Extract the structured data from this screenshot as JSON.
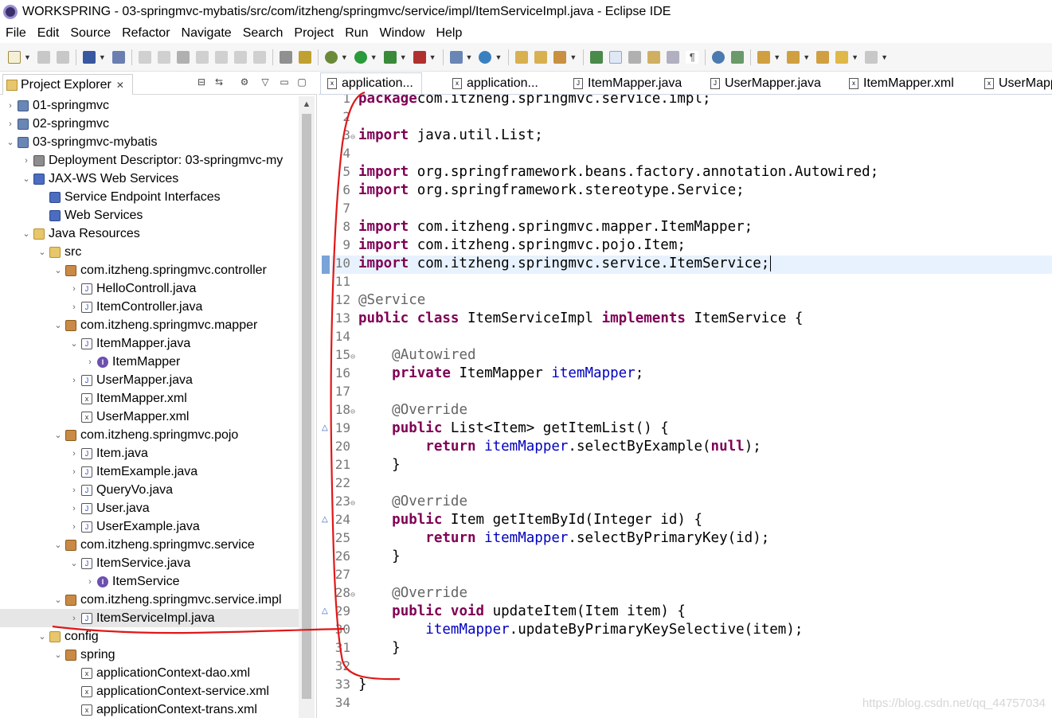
{
  "window": {
    "title": "WORKSPRING - 03-springmvc-mybatis/src/com/itzheng/springmvc/service/impl/ItemServiceImpl.java - Eclipse IDE"
  },
  "menu": [
    "File",
    "Edit",
    "Source",
    "Refactor",
    "Navigate",
    "Search",
    "Project",
    "Run",
    "Window",
    "Help"
  ],
  "explorer": {
    "title": "Project Explorer",
    "close": "✕",
    "tree": [
      {
        "label": "01-springmvc",
        "icon": "project-icon",
        "twisty": "›",
        "level": 0
      },
      {
        "label": "02-springmvc",
        "icon": "project-icon",
        "twisty": "›",
        "level": 0
      },
      {
        "label": "03-springmvc-mybatis",
        "icon": "project-icon",
        "twisty": "⌄",
        "level": 0
      },
      {
        "label": "Deployment Descriptor: 03-springmvc-my",
        "icon": "descriptor-icon",
        "twisty": "›",
        "level": 1
      },
      {
        "label": "JAX-WS Web Services",
        "icon": "webservice-icon",
        "twisty": "⌄",
        "level": 1
      },
      {
        "label": "Service Endpoint Interfaces",
        "icon": "webservice-icon",
        "twisty": "",
        "level": 2
      },
      {
        "label": "Web Services",
        "icon": "webservice-icon",
        "twisty": "",
        "level": 2
      },
      {
        "label": "Java Resources",
        "icon": "folder-icon",
        "twisty": "⌄",
        "level": 1
      },
      {
        "label": "src",
        "icon": "folder-icon",
        "twisty": "⌄",
        "level": 2
      },
      {
        "label": "com.itzheng.springmvc.controller",
        "icon": "package-icon",
        "twisty": "⌄",
        "level": 3
      },
      {
        "label": "HelloControll.java",
        "icon": "java-file-icon",
        "twisty": "›",
        "level": 4
      },
      {
        "label": "ItemController.java",
        "icon": "java-file-icon",
        "twisty": "›",
        "level": 4
      },
      {
        "label": "com.itzheng.springmvc.mapper",
        "icon": "package-icon",
        "twisty": "⌄",
        "level": 3
      },
      {
        "label": "ItemMapper.java",
        "icon": "java-file-icon",
        "twisty": "⌄",
        "level": 4
      },
      {
        "label": "ItemMapper",
        "icon": "interface-icon",
        "twisty": "›",
        "level": 5
      },
      {
        "label": "UserMapper.java",
        "icon": "java-file-icon",
        "twisty": "›",
        "level": 4
      },
      {
        "label": "ItemMapper.xml",
        "icon": "xml-file-icon",
        "twisty": "",
        "level": 4
      },
      {
        "label": "UserMapper.xml",
        "icon": "xml-file-icon",
        "twisty": "",
        "level": 4
      },
      {
        "label": "com.itzheng.springmvc.pojo",
        "icon": "package-icon",
        "twisty": "⌄",
        "level": 3
      },
      {
        "label": "Item.java",
        "icon": "java-file-icon",
        "twisty": "›",
        "level": 4
      },
      {
        "label": "ItemExample.java",
        "icon": "java-file-icon",
        "twisty": "›",
        "level": 4
      },
      {
        "label": "QueryVo.java",
        "icon": "java-file-icon",
        "twisty": "›",
        "level": 4
      },
      {
        "label": "User.java",
        "icon": "java-file-icon",
        "twisty": "›",
        "level": 4
      },
      {
        "label": "UserExample.java",
        "icon": "java-file-icon",
        "twisty": "›",
        "level": 4
      },
      {
        "label": "com.itzheng.springmvc.service",
        "icon": "package-icon",
        "twisty": "⌄",
        "level": 3
      },
      {
        "label": "ItemService.java",
        "icon": "java-file-icon",
        "twisty": "⌄",
        "level": 4
      },
      {
        "label": "ItemService",
        "icon": "interface-icon",
        "twisty": "›",
        "level": 5
      },
      {
        "label": "com.itzheng.springmvc.service.impl",
        "icon": "package-icon",
        "twisty": "⌄",
        "level": 3
      },
      {
        "label": "ItemServiceImpl.java",
        "icon": "java-file-icon",
        "twisty": "›",
        "level": 4,
        "selected": true
      },
      {
        "label": "config",
        "icon": "folder-icon",
        "twisty": "⌄",
        "level": 2
      },
      {
        "label": "spring",
        "icon": "package-icon",
        "twisty": "⌄",
        "level": 3
      },
      {
        "label": "applicationContext-dao.xml",
        "icon": "xml-file-icon",
        "twisty": "",
        "level": 4
      },
      {
        "label": "applicationContext-service.xml",
        "icon": "xml-file-icon",
        "twisty": "",
        "level": 4
      },
      {
        "label": "applicationContext-trans.xml",
        "icon": "xml-file-icon",
        "twisty": "",
        "level": 4
      }
    ]
  },
  "editor": {
    "tabs": [
      {
        "label": "application...",
        "kind": "x",
        "active": true
      },
      {
        "label": "application...",
        "kind": "x"
      },
      {
        "label": "ItemMapper.java",
        "kind": "J"
      },
      {
        "label": "UserMapper.java",
        "kind": "J"
      },
      {
        "label": "ItemMapper.xml",
        "kind": "x"
      },
      {
        "label": "UserMapp",
        "kind": "x"
      }
    ],
    "lines": [
      {
        "n": "1",
        "fold": "",
        "tokens": [
          [
            "kw",
            "package"
          ],
          [
            "",
            "com.itzheng.springmvc.service.impl;"
          ]
        ]
      },
      {
        "n": "2",
        "fold": "",
        "tokens": []
      },
      {
        "n": "3",
        "fold": "⊖",
        "tokens": [
          [
            "kw",
            "import"
          ],
          [
            "",
            " java.util.List;"
          ]
        ]
      },
      {
        "n": "4",
        "fold": "",
        "tokens": []
      },
      {
        "n": "5",
        "fold": "",
        "tokens": [
          [
            "kw",
            "import"
          ],
          [
            "",
            " org.springframework.beans.factory.annotation.Autowired;"
          ]
        ]
      },
      {
        "n": "6",
        "fold": "",
        "tokens": [
          [
            "kw",
            "import"
          ],
          [
            "",
            " org.springframework.stereotype.Service;"
          ]
        ]
      },
      {
        "n": "7",
        "fold": "",
        "tokens": []
      },
      {
        "n": "8",
        "fold": "",
        "tokens": [
          [
            "kw",
            "import"
          ],
          [
            "",
            " com.itzheng.springmvc.mapper.ItemMapper;"
          ]
        ]
      },
      {
        "n": "9",
        "fold": "",
        "tokens": [
          [
            "kw",
            "import"
          ],
          [
            "",
            " com.itzheng.springmvc.pojo.Item;"
          ]
        ]
      },
      {
        "n": "10",
        "fold": "",
        "tokens": [
          [
            "kw",
            "import"
          ],
          [
            "",
            " com.itzheng.springmvc.service.ItemService;"
          ]
        ]
      },
      {
        "n": "11",
        "fold": "",
        "tokens": []
      },
      {
        "n": "12",
        "fold": "",
        "tokens": [
          [
            "ann",
            "@Service"
          ]
        ]
      },
      {
        "n": "13",
        "fold": "",
        "tokens": [
          [
            "kw",
            "public class"
          ],
          [
            "",
            " ItemServiceImpl "
          ],
          [
            "kw",
            "implements"
          ],
          [
            "",
            " ItemService {"
          ]
        ]
      },
      {
        "n": "14",
        "fold": "",
        "tokens": []
      },
      {
        "n": "15",
        "fold": "⊖",
        "tokens": [
          [
            "",
            "    "
          ],
          [
            "ann",
            "@Autowired"
          ]
        ]
      },
      {
        "n": "16",
        "fold": "",
        "tokens": [
          [
            "",
            "    "
          ],
          [
            "kw",
            "private"
          ],
          [
            "",
            " ItemMapper "
          ],
          [
            "fld",
            "itemMapper"
          ],
          [
            "",
            ";"
          ]
        ]
      },
      {
        "n": "17",
        "fold": "",
        "tokens": []
      },
      {
        "n": "18",
        "fold": "⊖",
        "tokens": [
          [
            "",
            "    "
          ],
          [
            "ann",
            "@Override"
          ]
        ]
      },
      {
        "n": "19",
        "fold": "",
        "tokens": [
          [
            "",
            "    "
          ],
          [
            "kw",
            "public"
          ],
          [
            "",
            " List<Item> getItemList() {"
          ]
        ]
      },
      {
        "n": "20",
        "fold": "",
        "tokens": [
          [
            "",
            "        "
          ],
          [
            "kw",
            "return"
          ],
          [
            "",
            " "
          ],
          [
            "fld",
            "itemMapper"
          ],
          [
            "",
            ".selectByExample("
          ],
          [
            "kw",
            "null"
          ],
          [
            "",
            ");"
          ]
        ]
      },
      {
        "n": "21",
        "fold": "",
        "tokens": [
          [
            "",
            "    }"
          ]
        ]
      },
      {
        "n": "22",
        "fold": "",
        "tokens": []
      },
      {
        "n": "23",
        "fold": "⊖",
        "tokens": [
          [
            "",
            "    "
          ],
          [
            "ann",
            "@Override"
          ]
        ]
      },
      {
        "n": "24",
        "fold": "",
        "tokens": [
          [
            "",
            "    "
          ],
          [
            "kw",
            "public"
          ],
          [
            "",
            " Item getItemById(Integer id) {"
          ]
        ]
      },
      {
        "n": "25",
        "fold": "",
        "tokens": [
          [
            "",
            "        "
          ],
          [
            "kw",
            "return"
          ],
          [
            "",
            " "
          ],
          [
            "fld",
            "itemMapper"
          ],
          [
            "",
            ".selectByPrimaryKey(id);"
          ]
        ]
      },
      {
        "n": "26",
        "fold": "",
        "tokens": [
          [
            "",
            "    }"
          ]
        ]
      },
      {
        "n": "27",
        "fold": "",
        "tokens": []
      },
      {
        "n": "28",
        "fold": "⊖",
        "tokens": [
          [
            "",
            "    "
          ],
          [
            "ann",
            "@Override"
          ]
        ]
      },
      {
        "n": "29",
        "fold": "",
        "tokens": [
          [
            "",
            "    "
          ],
          [
            "kw",
            "public void"
          ],
          [
            "",
            " updateItem(Item item) {"
          ]
        ]
      },
      {
        "n": "30",
        "fold": "",
        "tokens": [
          [
            "",
            "        "
          ],
          [
            "fld",
            "itemMapper"
          ],
          [
            "",
            ".updateByPrimaryKeySelective(item);"
          ]
        ]
      },
      {
        "n": "31",
        "fold": "",
        "tokens": [
          [
            "",
            "    }"
          ]
        ]
      },
      {
        "n": "32",
        "fold": "",
        "tokens": []
      },
      {
        "n": "33",
        "fold": "",
        "tokens": [
          [
            "",
            "}"
          ]
        ]
      },
      {
        "n": "34",
        "fold": "",
        "tokens": []
      }
    ]
  },
  "watermark": "https://blog.csdn.net/qq_44757034",
  "colors": {
    "keyword": "#7f0055",
    "field": "#0000c0",
    "annotation": "#646464",
    "current_line": "#e8f2fe",
    "pen": "#e01818"
  }
}
